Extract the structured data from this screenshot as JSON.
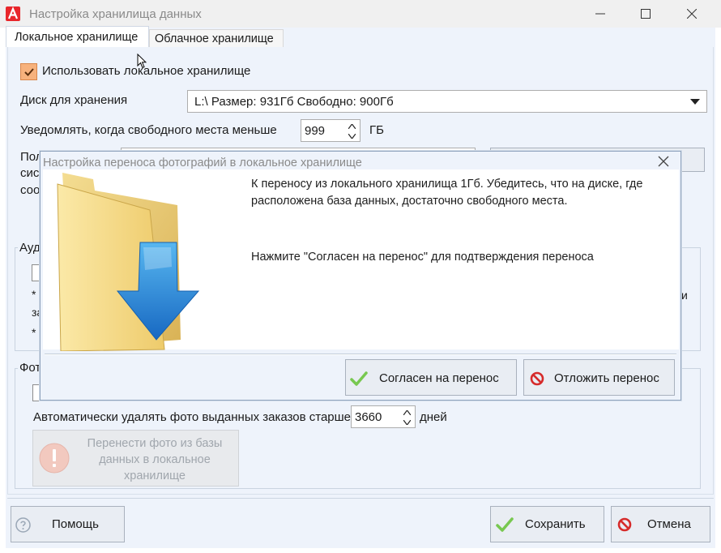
{
  "window": {
    "title": "Настройка хранилища данных",
    "minimize_label": "Свернуть",
    "maximize_label": "Развернуть",
    "close_label": "Закрыть"
  },
  "tabs": [
    {
      "label": "Локальное хранилище",
      "active": true
    },
    {
      "label": "Облачное хранилище",
      "active": false
    }
  ],
  "local": {
    "use_local": {
      "label": "Использовать локальное хранилище",
      "checked": true
    },
    "disk": {
      "label": "Диск для хранения",
      "value": "L:\\ Размер: 931Гб Свободно: 900Гб"
    },
    "notify": {
      "label": "Уведомлять, когда свободного места меньше",
      "value": "999",
      "unit": "ГБ"
    },
    "path_partial_lines": [
      "Пол",
      "сис",
      "соо"
    ],
    "audit_group_title_partial": "Ауд",
    "audit_note_partial": [
      "*",
      "за",
      "*"
    ],
    "audit_right_fragment": "и",
    "photo_group_title_partial": "Фот",
    "auto_delete": {
      "label": "Автоматически удалять фото выданных заказов старше",
      "value": "3660",
      "unit": "дней"
    },
    "move_photos_button": {
      "lines": [
        "Перенести фото из базы",
        "данных в локальное",
        "хранилище"
      ]
    }
  },
  "footer": {
    "help_label": "Помощь",
    "save_label": "Сохранить",
    "cancel_label": "Отмена"
  },
  "modal": {
    "title": "Настройка переноса фотографий в локальное хранилище",
    "message_lines": [
      "К переносу из локального хранилища  1Гб. Убедитесь, что на диске, где",
      "расположена база данных, достаточно свободного места."
    ],
    "prompt": "Нажмите \"Согласен на перенос\" для подтверждения переноса",
    "agree_label": "Согласен на перенос",
    "postpone_label": "Отложить перенос"
  },
  "colors": {
    "accent_checkbox": "#f7b27d",
    "client_bg": "#eef3fb",
    "button_bg": "#e9edf3",
    "check_green": "#78c850",
    "stop_red": "#d62b2b"
  }
}
